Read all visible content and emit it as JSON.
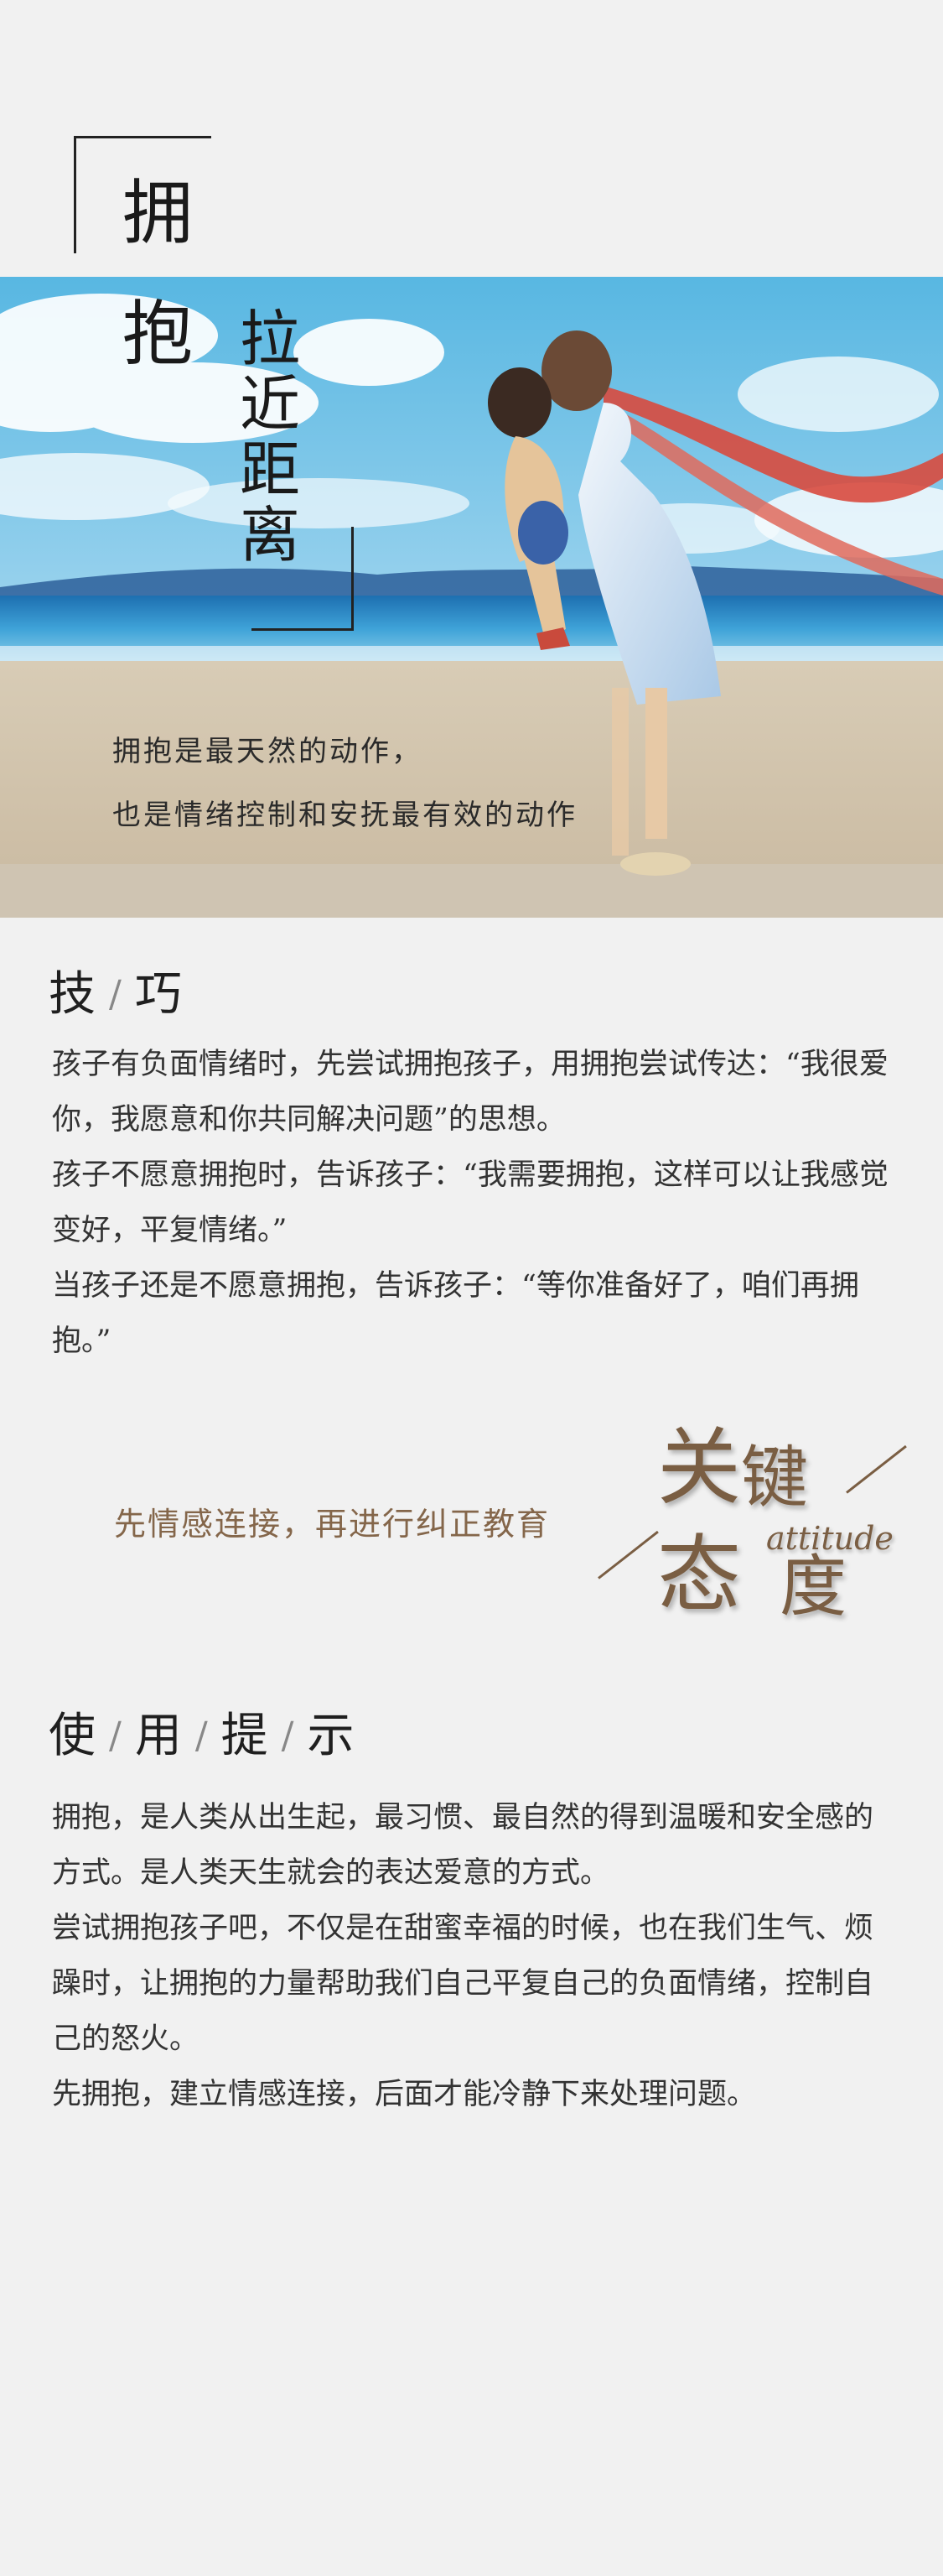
{
  "title": {
    "chars_col1": [
      "拥",
      "抱"
    ],
    "chars_col2": [
      "拉",
      "近",
      "距",
      "离"
    ]
  },
  "hero": {
    "caption_line1": "拥抱是最天然的动作，",
    "caption_line2": "也是情绪控制和安抚最有效的动作"
  },
  "skills": {
    "heading": [
      "技",
      "巧"
    ],
    "paragraphs": [
      "孩子有负面情绪时，先尝试拥抱孩子，用拥抱尝试传达：“我很爱你，我愿意和你共同解决问题”的思想。",
      "孩子不愿意拥抱时，告诉孩子：“我需要拥抱，这样可以让我感觉变好，平复情绪。”",
      "当孩子还是不愿意拥抱，告诉孩子：“等你准备好了，咱们再拥抱。”"
    ]
  },
  "key_attitude": {
    "text": "先情感连接，再进行纠正教育",
    "big1": "关",
    "big2": "键",
    "big3": "态",
    "big4": "度",
    "english": "attitude",
    "color": "#7a5e43"
  },
  "tips": {
    "heading": [
      "使",
      "用",
      "提",
      "示"
    ],
    "paragraphs": [
      "拥抱，是人类从出生起，最习惯、最自然的得到温暖和安全感的方式。是人类天生就会的表达爱意的方式。",
      "尝试拥抱孩子吧，不仅是在甜蜜幸福的时候，也在我们生气、烦躁时，让拥抱的力量帮助我们自己平复自己的负面情绪，控制自己的怒火。",
      "先拥抱，建立情感连接，后面才能冷静下来处理问题。"
    ]
  }
}
